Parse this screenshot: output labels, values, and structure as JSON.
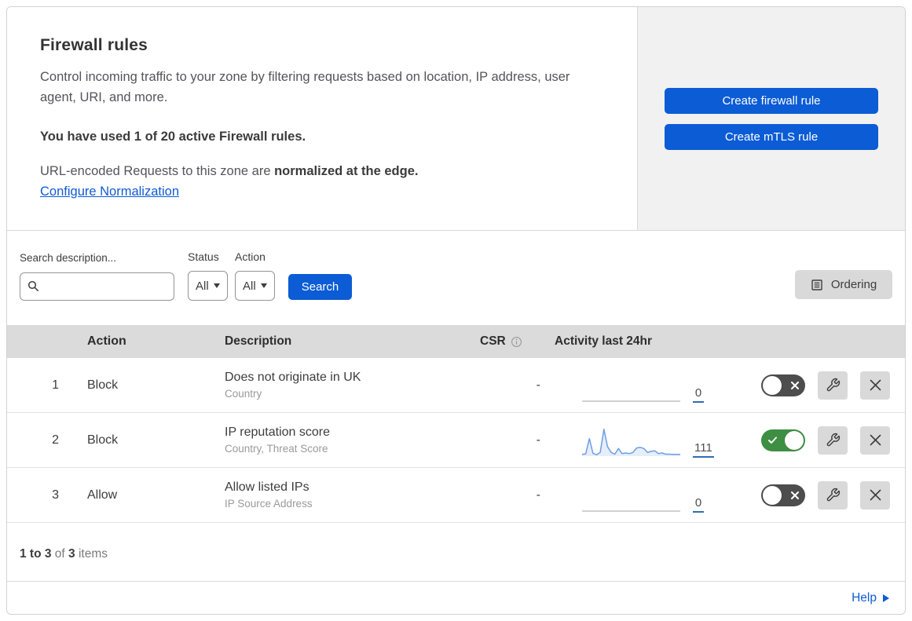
{
  "header": {
    "title": "Firewall rules",
    "description": "Control incoming traffic to your zone by filtering requests based on location, IP address, user agent, URI, and more.",
    "usage_notice": "You have used 1 of 20 active Firewall rules.",
    "normalization_text": "URL-encoded Requests to this zone are ",
    "normalization_bold": "normalized at the edge.",
    "normalization_link": "Configure Normalization",
    "create_firewall_button": "Create firewall rule",
    "create_mtls_button": "Create mTLS rule"
  },
  "filters": {
    "search_label": "Search description...",
    "status_label": "Status",
    "status_value": "All",
    "action_label": "Action",
    "action_value": "All",
    "search_button": "Search",
    "ordering_button": "Ordering"
  },
  "table": {
    "headers": {
      "action": "Action",
      "description": "Description",
      "csr": "CSR",
      "activity": "Activity last 24hr"
    },
    "rows": [
      {
        "priority": "1",
        "action": "Block",
        "description": "Does not originate in UK",
        "expression_fields": "Country",
        "csr": "-",
        "activity_count": "0",
        "enabled": false,
        "sparkline": [
          0,
          0
        ],
        "spark_color": "#c2c2c2",
        "spark_fill": "none"
      },
      {
        "priority": "2",
        "action": "Block",
        "description": "IP reputation score",
        "expression_fields": "Country, Threat Score",
        "csr": "-",
        "activity_count": "111",
        "enabled": true,
        "sparkline": [
          6,
          8,
          62,
          10,
          5,
          13,
          95,
          34,
          13,
          7,
          27,
          9,
          11,
          9,
          13,
          29,
          31,
          27,
          13,
          17,
          19,
          9,
          11,
          7,
          7,
          6,
          6,
          6
        ],
        "spark_color": "#6f9ee3",
        "spark_fill": "rgba(111,158,227,0.18)"
      },
      {
        "priority": "3",
        "action": "Allow",
        "description": "Allow listed IPs",
        "expression_fields": "IP Source Address",
        "csr": "-",
        "activity_count": "0",
        "enabled": false,
        "sparkline": [
          0,
          0
        ],
        "spark_color": "#c2c2c2",
        "spark_fill": "none"
      }
    ]
  },
  "footer": {
    "range": "1 to 3",
    "of_text": " of ",
    "total": "3",
    "items_text": " items",
    "help_link": "Help"
  },
  "colors": {
    "accent_blue": "#0b5cd5",
    "link_blue": "#0f5bd6",
    "toggle_on_green": "#3e8e44",
    "toggle_off_gray": "#4d4d4d",
    "panel_gray": "#f1f1f1",
    "table_header_gray": "#dbdbdb",
    "icon_button_gray": "#d9d9d9",
    "count_underline_blue": "#2e6db4",
    "sparkline_blue": "#6f9ee3"
  }
}
